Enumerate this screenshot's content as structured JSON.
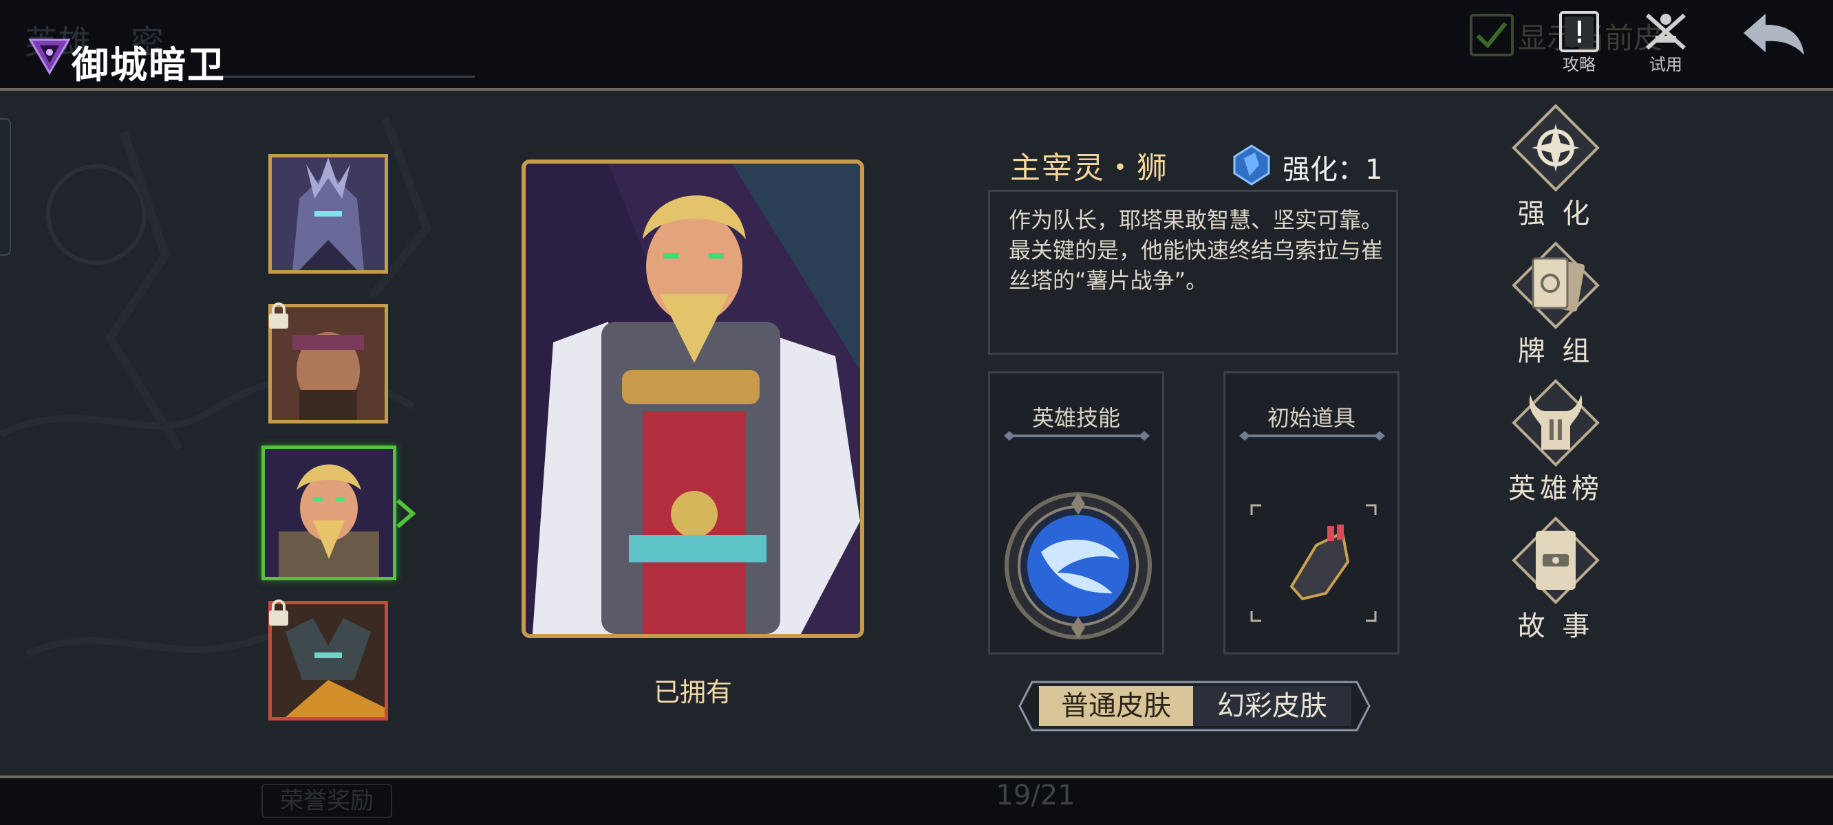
{
  "header": {
    "title": "御城暗卫",
    "ghost_tab_1": "英雄",
    "ghost_tab_2": "密",
    "show_current_skin_label": "显示当前皮",
    "guide_label": "攻略",
    "trial_label": "试用"
  },
  "roster": {
    "count": 4,
    "selected_index": 2,
    "locked": [
      false,
      true,
      false,
      true
    ]
  },
  "hero": {
    "name": "主宰灵・狮",
    "enhance_label": "强化：1",
    "description": "作为队长，耶塔果敢智慧、坚实可靠。最关键的是，他能快速终结乌索拉与崔丝塔的“薯片战争”。",
    "owned_status": "已拥有",
    "skill_title": "英雄技能",
    "item_title": "初始道具",
    "skin_normal": "普通皮肤",
    "skin_colorful": "幻彩皮肤"
  },
  "menu": {
    "enhance": "强 化",
    "deck": "牌 组",
    "ranking": "英雄榜",
    "story": "故 事"
  },
  "footer": {
    "honor_reward": "荣誉奖励",
    "page": "19/21"
  },
  "colors": {
    "gold": "#c79a4c",
    "selected_green": "#54c23b",
    "locked_red": "#c64b3a",
    "panel_bg": "#20242b"
  },
  "icons": [
    "hero-class-icon",
    "guide-icon",
    "trial-icon",
    "back-arrow-icon",
    "lock-icon",
    "enhance-crystal-icon",
    "enhance-icon",
    "deck-icon",
    "ranking-icon",
    "story-icon",
    "skill-icon",
    "gauntlet-item-icon"
  ]
}
